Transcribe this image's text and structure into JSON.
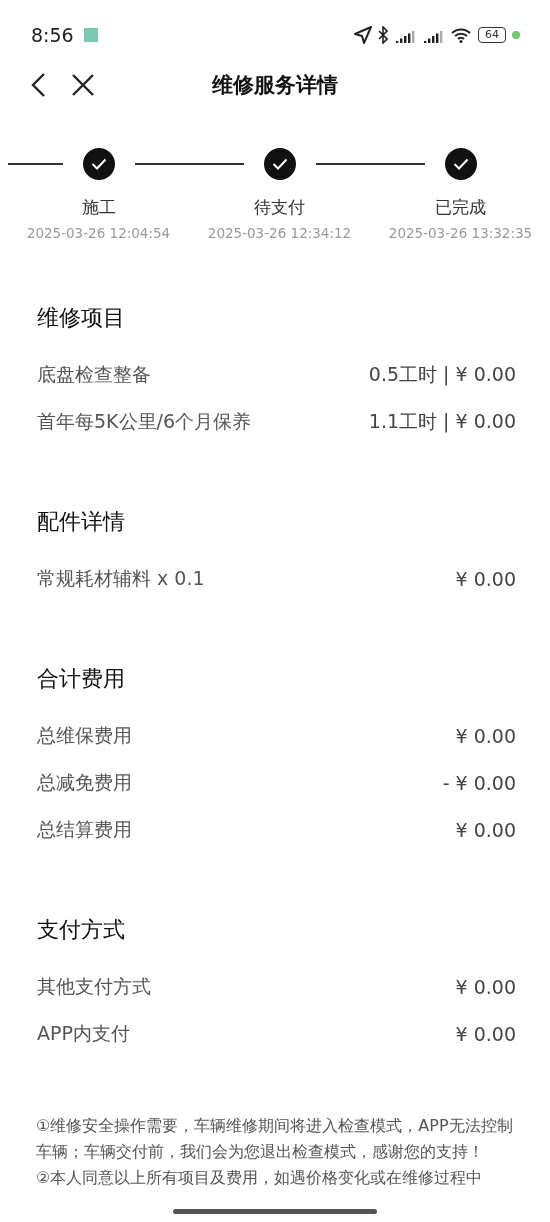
{
  "status_bar": {
    "time": "8:56",
    "battery": "64"
  },
  "nav": {
    "title": "维修服务详情"
  },
  "steps": [
    {
      "label": "施工",
      "time": "2025-03-26 12:04:54",
      "done": true
    },
    {
      "label": "待支付",
      "time": "2025-03-26 12:34:12",
      "done": true
    },
    {
      "label": "已完成",
      "time": "2025-03-26 13:32:35",
      "done": true
    }
  ],
  "sections": [
    {
      "title": "维修项目",
      "rows": [
        {
          "label": "底盘检查整备",
          "value": "0.5工时 | ¥ 0.00"
        },
        {
          "label": "首年每5K公里/6个月保养",
          "value": "1.1工时 | ¥ 0.00"
        }
      ]
    },
    {
      "title": "配件详情",
      "rows": [
        {
          "label": "常规耗材辅料 x 0.1",
          "value": "¥ 0.00"
        }
      ]
    },
    {
      "title": "合计费用",
      "rows": [
        {
          "label": "总维保费用",
          "value": "¥ 0.00"
        },
        {
          "label": "总减免费用",
          "value": "- ¥ 0.00"
        },
        {
          "label": "总结算费用",
          "value": "¥ 0.00"
        }
      ]
    },
    {
      "title": "支付方式",
      "rows": [
        {
          "label": "其他支付方式",
          "value": "¥ 0.00"
        },
        {
          "label": "APP内支付",
          "value": "¥ 0.00"
        }
      ]
    }
  ],
  "notes": [
    "①维修安全操作需要，车辆维修期间将进入检查模式，APP无法控制车辆；车辆交付前，我们会为您退出检查模式，感谢您的支持！",
    "②本人同意以上所有项目及费用，如遇价格变化或在维修过程中"
  ]
}
